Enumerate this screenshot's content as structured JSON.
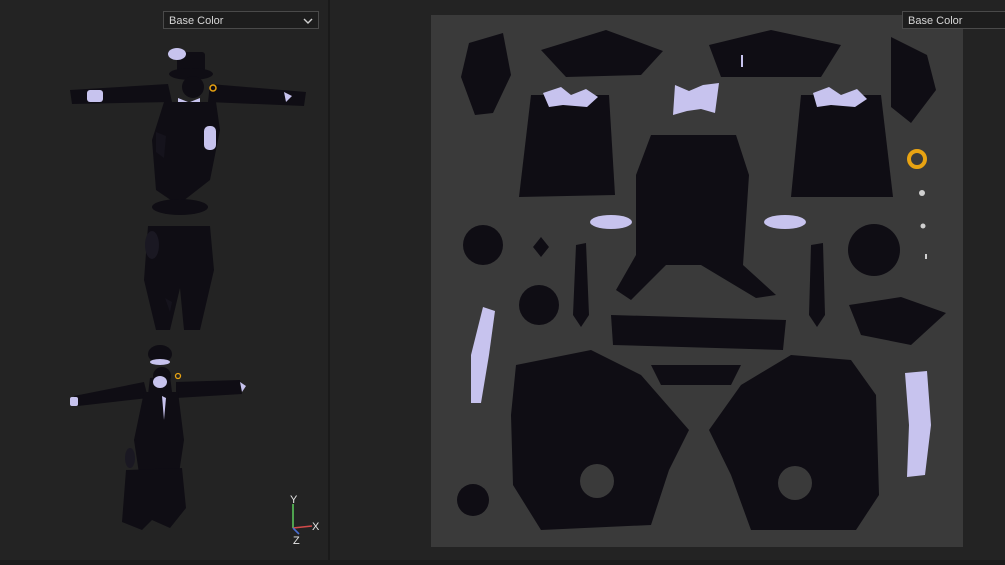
{
  "left_viewport": {
    "channel_dropdown": {
      "value": "Base Color"
    },
    "axis_gizmo": {
      "x_label": "X",
      "y_label": "Y",
      "z_label": "Z"
    }
  },
  "right_viewport": {
    "channel_dropdown": {
      "value": "Base Color"
    }
  },
  "colors": {
    "background": "#232323",
    "uv_background": "#3a3a3a",
    "mesh_dark": "#0f0d14",
    "accent_lavender": "#c7c3ee",
    "accent_gold": "#e8a312"
  }
}
